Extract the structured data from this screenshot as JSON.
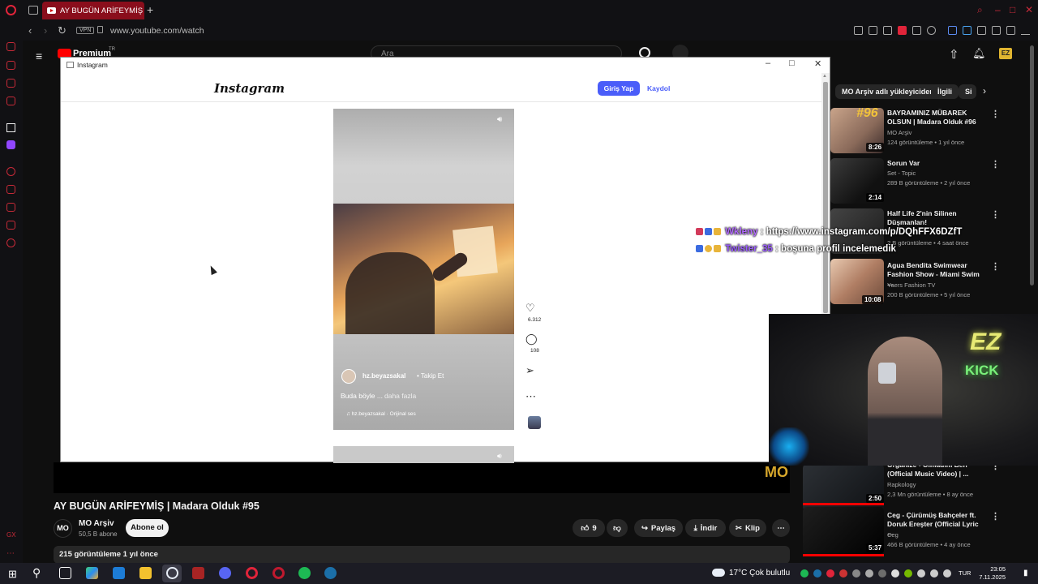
{
  "browser": {
    "tab_title": "AY BUGÜN ARİFEYMİŞ | M",
    "new_tab": "+",
    "url": "www.youtube.com/watch",
    "vpn": "VPN",
    "window_controls": [
      "⌕",
      "–",
      "□",
      "✕"
    ]
  },
  "youtube": {
    "menu_icon": "≡",
    "logo_text": "Premium",
    "logo_region": "TR",
    "search_placeholder": "Ara",
    "video_title": "AY BUGÜN ARİFEYMİŞ | Madara Olduk #95",
    "watermark": "MO",
    "channel": {
      "avatar": "MO",
      "name": "MO Arşiv",
      "subs": "50,5 B abone",
      "subscribe": "Abone ol"
    },
    "actions": {
      "likes": "9",
      "share": "Paylaş",
      "download": "İndir",
      "clip": "Klip",
      "more": "⋯"
    },
    "views": "215 görüntüleme   1 yıl önce",
    "chips": [
      "MO Arşiv adlı yükleyiciden",
      "İlgili",
      "Si"
    ],
    "recommendations": [
      {
        "title": "BAYRAMINIZ MÜBAREK OLSUN | Madara Olduk #96",
        "channel": "MO Arşiv",
        "meta": "124 görüntüleme • 1 yıl önce",
        "duration": "8:26",
        "badge": "#96"
      },
      {
        "title": "Sorun Var",
        "channel": "Set - Topic",
        "meta": "289 B görüntüleme • 2 yıl önce",
        "duration": "2:14"
      },
      {
        "title": "Half Life 2'nin Silinen Düşmanları!",
        "channel": "",
        "meta": "2 B görüntüleme • 4 saat önce",
        "duration": ""
      },
      {
        "title": "Agua Bendita Swimwear Fashion Show - Miami Swim ...",
        "channel": "Yaers Fashion TV",
        "meta": "200 B görüntüleme • 5 yıl önce",
        "duration": "10:08"
      }
    ],
    "recommendations_lower": [
      {
        "title": "Organize - Olmadım Ben (Official Music Video) | ...",
        "channel": "Rapkology",
        "meta": "2,3 Mn görüntüleme • 8 ay önce",
        "duration": "2:50"
      },
      {
        "title": "Ceg - Çürümüş Bahçeler ft. Doruk Ereşter (Official Lyric ...",
        "channel": "Ceg",
        "meta": "466 B görüntüleme • 4 ay önce",
        "duration": "5:37"
      }
    ]
  },
  "instagram": {
    "window_title": "Instagram",
    "window_controls": [
      "–",
      "□",
      "✕"
    ],
    "logo": "Instagram",
    "login": "Giriş Yap",
    "signup": "Kaydol",
    "reel": {
      "username": "hz.beyazsakal",
      "follow": "• Takip Et",
      "caption": "Buda böyle ...",
      "caption_more": "daha fazla",
      "audio": "♫ hz.beyazsakal · Orijinal ses",
      "likes": "6.312",
      "comments": "108"
    }
  },
  "chat": [
    {
      "user": "Wkleny",
      "message": ": https://www.instagram.com/p/DQhFFX6DZfT",
      "color": "#b36bff"
    },
    {
      "user": "Twister_35",
      "message": ": boşuna profil incelemedik",
      "color": "#9b5cff"
    }
  ],
  "webcam": {
    "neon_top": "EZ",
    "neon_bottom": "KICK"
  },
  "taskbar": {
    "weather": "17°C  Çok bulutlu",
    "lang": "TUR",
    "time": "23:05",
    "date": "7.11.2025"
  },
  "colors": {
    "accent_red": "#e0243a",
    "instagram_blue": "#4a5df9",
    "youtube_red": "#ff0000"
  }
}
